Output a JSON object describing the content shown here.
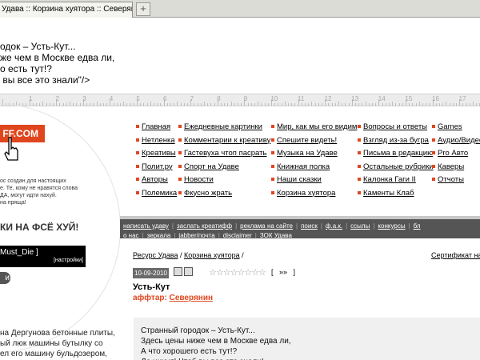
{
  "browser": {
    "tab_title": "Удава :: Корзина хуятора :: Северянин - У...",
    "new_tab_glyph": "+"
  },
  "header_text": "одок – Усть-Кут...\nже чем в Москве едва ли,\nо есть тут!?\n вы все это знали\"/>",
  "ruler": {
    "numbers": [
      "1",
      "2",
      "3",
      "4",
      "5",
      "6",
      "7",
      "8",
      "9",
      "10",
      "11",
      "12",
      "13",
      "14",
      "15",
      "16",
      "17"
    ]
  },
  "logo": {
    "text": "FF.COM"
  },
  "intro_text": "ос создан для настоящих\nе. Те, кому не нравятся слова\nДА, могут идти нахуй.\nна пряща!",
  "slogan": "КИ НА ФСЁ ХУЙ!",
  "user": {
    "name": "Must_Die ]",
    "settings": "[настройки]"
  },
  "exit": {
    "label": "и"
  },
  "left_article": "на Дергунова бетонные плиты,\nый люк машины бутылку со\nел его машину бульдозером,",
  "nav": {
    "columns": [
      [
        "Главная",
        "Нетленка",
        "Креативы",
        "Полит.ру",
        "Авторы",
        "Полемика"
      ],
      [
        "Ежедневные картинки",
        "Комментарии к креативу",
        "Гастевуха чтоп пасрать",
        "Спорт на Удаве",
        "Новости",
        "Фкусно жрать"
      ],
      [
        "Мир, как мы его видим",
        "Спешите видеть!",
        "Музыка на Удаве",
        "Книжная полка",
        "Наши сказки",
        "Корзина хуятора"
      ],
      [
        "Вопросы и ответы",
        "Взгляд из-за бугра",
        "Письма в редакцию",
        "Остальные рубрики",
        "Калонка Гаги II",
        "Каменты Клаб"
      ],
      [
        "Games",
        "Аудио/Видео",
        "Pro Авто",
        "Каверы",
        "Отчоты"
      ]
    ]
  },
  "menu": {
    "row1": [
      "написать удаву",
      "заслать креатифф",
      "реклама на сайте",
      "поиск",
      "ф.а.к.",
      "ссылы",
      "конкурсы",
      "бл"
    ],
    "row2": [
      "о нас",
      "зеркала",
      "jabber/почта",
      "disclaimer",
      "ЗОК Удава"
    ]
  },
  "breadcrumbs": [
    "Ресурс Удава",
    "Корзина хуятора"
  ],
  "breadcrumb_sep": "/",
  "certificate": "Сертификат на",
  "post": {
    "date": "10-09-2010",
    "stars": "☆☆☆☆☆☆☆☆",
    "nav_arrows": "[   »»   ]",
    "title": "Усть-Кут",
    "author_prefix": "аффтар:",
    "author": "Северянин",
    "body": "Странный городок – Усть-Кут...\nЗдесь цены ниже чем в Москве едва ли,\nА что хорошего есть тут!?\nДа нихуя! Чтоб вы все это знали!"
  },
  "colors": {
    "accent": "#e0461e",
    "menu_bg": "#555555"
  }
}
